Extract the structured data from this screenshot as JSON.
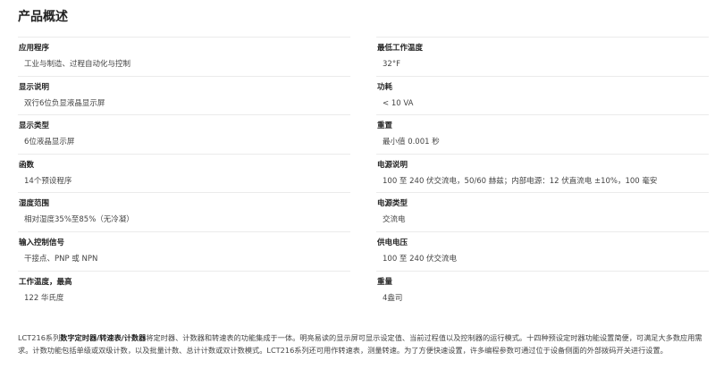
{
  "title": "产品概述",
  "left_specs": [
    {
      "label": "应用程序",
      "value": "工业与制造、过程自动化与控制"
    },
    {
      "label": "显示说明",
      "value": "双行6位负显液晶显示屏"
    },
    {
      "label": "显示类型",
      "value": "6位液晶显示屏"
    },
    {
      "label": "函数",
      "value": "14个预设程序"
    },
    {
      "label": "湿度范围",
      "value": "相对湿度35%至85%（无冷凝）"
    },
    {
      "label": "输入控制信号",
      "value": "干接点、PNP 或 NPN"
    },
    {
      "label": "工作温度，最高",
      "value": "122 华氏度"
    }
  ],
  "right_specs": [
    {
      "label": "最低工作温度",
      "value": "32°F"
    },
    {
      "label": "功耗",
      "value": "< 10 VA"
    },
    {
      "label": "重置",
      "value": "最小值 0.001 秒"
    },
    {
      "label": "电源说明",
      "value": "100 至 240 伏交流电，50/60 赫兹；内部电源：12 伏直流电 ±10%，100 毫安"
    },
    {
      "label": "电源类型",
      "value": "交流电"
    },
    {
      "label": "供电电压",
      "value": "100 至 240 伏交流电"
    },
    {
      "label": "重量",
      "value": "4盎司"
    }
  ],
  "description": {
    "part1": "LCT216系列",
    "bold": "数字定时器/转速表/计数器",
    "part2": "将定时器、计数器和转速表的功能集成于一体。明亮易读的显示屏可显示设定值、当前过程值以及控制器的运行模式。十四种预设定时器功能设置简便，可满足大多数应用需求。计数功能包括单级或双级计数，以及批量计数、总计计数或双计数模式。LCT216系列还可用作转速表，测量转速。为了方便快速设置，许多编程参数可通过位于设备侧面的外部拨码开关进行设置。"
  }
}
